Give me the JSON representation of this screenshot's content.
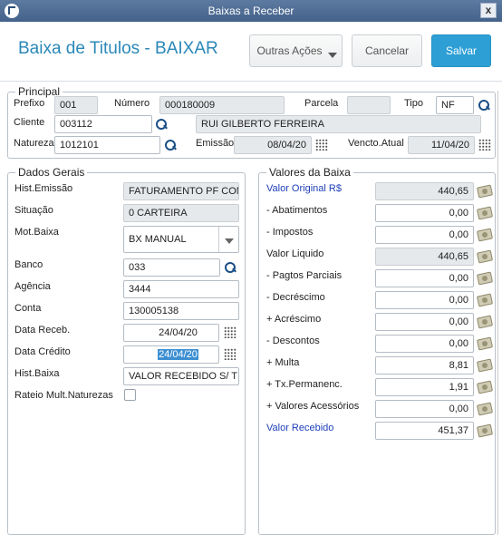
{
  "window": {
    "title": "Baixas a Receber",
    "close": "x"
  },
  "header": {
    "title": "Baixa de Titulos - BAIXAR",
    "other_actions": "Outras Ações",
    "cancel": "Cancelar",
    "save": "Salvar"
  },
  "principal": {
    "title": "Principal",
    "prefixo": {
      "label": "Prefixo",
      "value": "001"
    },
    "numero": {
      "label": "Número",
      "value": "000180009"
    },
    "parcela": {
      "label": "Parcela",
      "value": ""
    },
    "tipo": {
      "label": "Tipo",
      "value": "NF"
    },
    "cliente": {
      "label": "Cliente",
      "code": "003112",
      "name": "RUI GILBERTO FERREIRA"
    },
    "natureza": {
      "label": "Natureza",
      "value": "1012101"
    },
    "emissao": {
      "label": "Emissão",
      "value": "08/04/20"
    },
    "vencto": {
      "label": "Vencto.Atual",
      "value": "11/04/20"
    }
  },
  "dados": {
    "title": "Dados Gerais",
    "hist_emissao": {
      "label": "Hist.Emissão",
      "value": "FATURAMENTO PF COMI"
    },
    "situacao": {
      "label": "Situação",
      "value": "0 CARTEIRA"
    },
    "mot_baixa": {
      "label": "Mot.Baixa",
      "value": "BX MANUAL"
    },
    "banco": {
      "label": "Banco",
      "value": "033"
    },
    "agencia": {
      "label": "Agência",
      "value": "3444"
    },
    "conta": {
      "label": "Conta",
      "value": "130005138"
    },
    "data_receb": {
      "label": "Data Receb.",
      "value": "24/04/20"
    },
    "data_credito": {
      "label": "Data Crédito",
      "value": "24/04/20"
    },
    "hist_baixa": {
      "label": "Hist.Baixa",
      "value": "VALOR RECEBIDO S/ TIT"
    },
    "rateio": {
      "label": "Rateio Mult.Naturezas",
      "checked": false
    }
  },
  "valores": {
    "title": "Valores da Baixa",
    "rows": [
      {
        "label": "Valor Original R$",
        "value": "440,65"
      },
      {
        "label": "- Abatimentos",
        "value": "0,00"
      },
      {
        "label": "- Impostos",
        "value": "0,00"
      },
      {
        "label": "Valor Liquido",
        "value": "440,65"
      },
      {
        "label": "- Pagtos Parciais",
        "value": "0,00"
      },
      {
        "label": "- Decréscimo",
        "value": "0,00"
      },
      {
        "label": "+ Acréscimo",
        "value": "0,00"
      },
      {
        "label": "- Descontos",
        "value": "0,00"
      },
      {
        "label": "+ Multa",
        "value": "8,81"
      },
      {
        "label": "+ Tx.Permanenc.",
        "value": "1,91"
      },
      {
        "label": "+ Valores Acessórios",
        "value": "0,00"
      },
      {
        "label": "Valor Recebido",
        "value": "451,37"
      }
    ]
  },
  "colors": {
    "accent": "#2a88b8",
    "save": "#2d9fd5",
    "link_label": "#1d3fb8"
  },
  "icons": [
    "search-icon",
    "calendar-icon",
    "money-icon",
    "chevron-down-icon",
    "close-icon"
  ]
}
